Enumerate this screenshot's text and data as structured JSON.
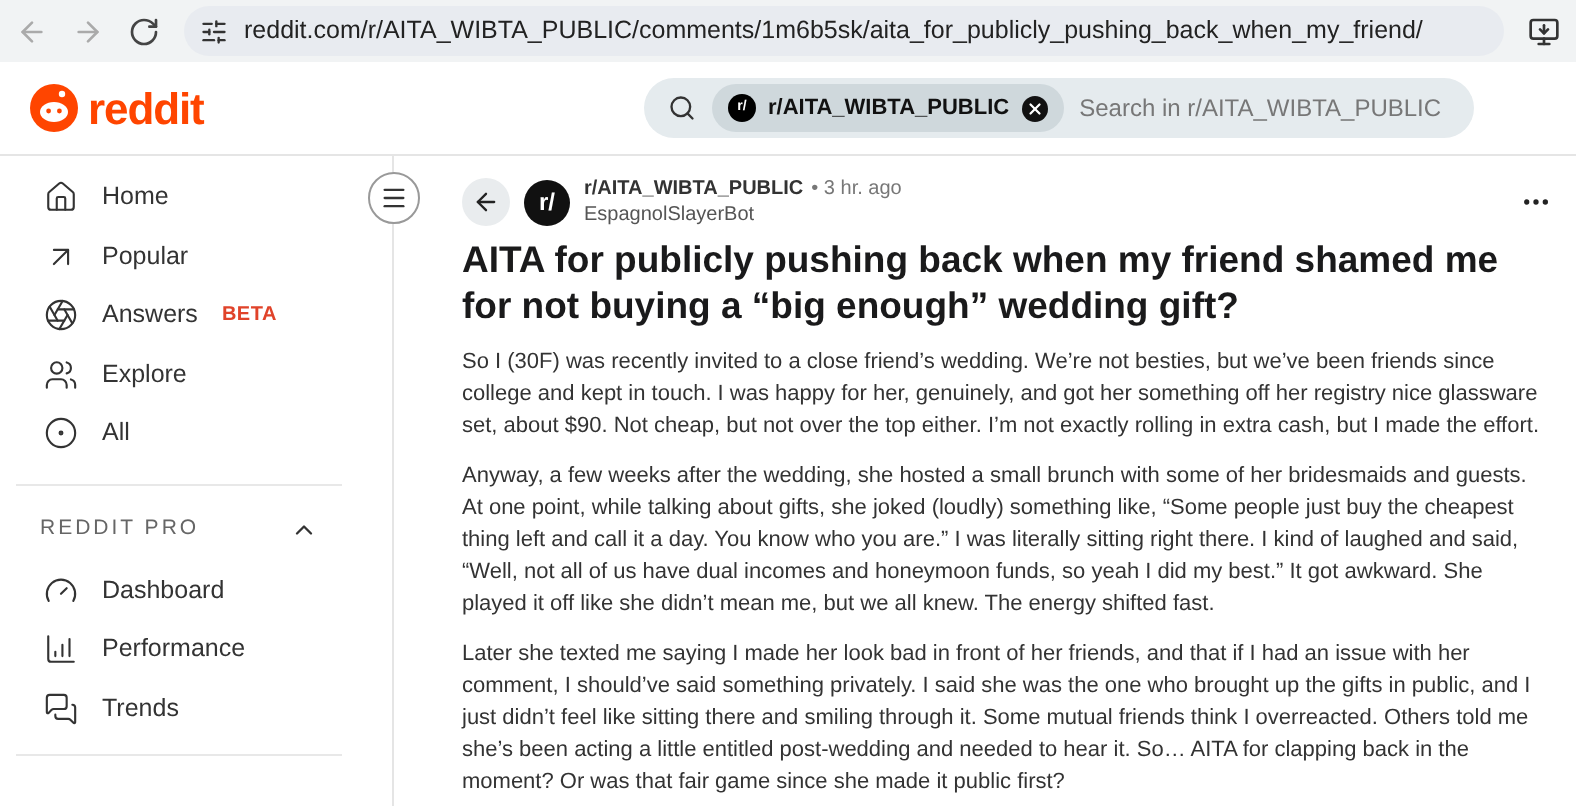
{
  "browser": {
    "url": "reddit.com/r/AITA_WIBTA_PUBLIC/comments/1m6b5sk/aita_for_publicly_pushing_back_when_my_friend/"
  },
  "header": {
    "logo_text": "reddit",
    "search_chip": "r/AITA_WIBTA_PUBLIC",
    "chip_avatar": "r/",
    "placeholder": "Search in r/AITA_WIBTA_PUBLIC"
  },
  "sidebar": {
    "items": [
      {
        "label": "Home",
        "kind": "home"
      },
      {
        "label": "Popular",
        "kind": "popular"
      },
      {
        "label": "Answers",
        "kind": "answers",
        "badge": "BETA"
      },
      {
        "label": "Explore",
        "kind": "explore"
      },
      {
        "label": "All",
        "kind": "all"
      }
    ],
    "section": {
      "title": "REDDIT PRO",
      "expanded": true,
      "items": [
        {
          "label": "Dashboard",
          "kind": "dashboard"
        },
        {
          "label": "Performance",
          "kind": "performance"
        },
        {
          "label": "Trends",
          "kind": "trends"
        }
      ]
    }
  },
  "post": {
    "subreddit": "r/AITA_WIBTA_PUBLIC",
    "avatar": "r/",
    "time": "• 3 hr. ago",
    "author": "EspagnolSlayerBot",
    "title": "AITA for publicly pushing back when my friend shamed me for not buying a “big enough” wedding gift?",
    "paragraphs": [
      "So I (30F) was recently invited to a close friend’s wedding. We’re not besties, but we’ve been friends since college and kept in touch. I was happy for her, genuinely, and got her something off her registry nice glassware set, about $90. Not cheap, but not over the top either. I’m not exactly rolling in extra cash, but I made the effort.",
      "Anyway, a few weeks after the wedding, she hosted a small brunch with some of her bridesmaids and guests. At one point, while talking about gifts, she joked (loudly) something like, “Some people just buy the cheapest thing left and call it a day. You know who you are.” I was literally sitting right there. I kind of laughed and said, “Well, not all of us have dual incomes and honeymoon funds, so yeah I did my best.” It got awkward. She played it off like she didn’t mean me, but we all knew. The energy shifted fast.",
      "Later she texted me saying I made her look bad in front of her friends, and that if I had an issue with her comment, I should’ve said something privately. I said she was the one who brought up the gifts in public, and I just didn’t feel like sitting there and smiling through it. Some mutual friends think I overreacted. Others told me she’s been acting a little entitled post-wedding and needed to hear it. So… AITA for clapping back in the moment? Or was that fair game since she made it public first?"
    ]
  }
}
